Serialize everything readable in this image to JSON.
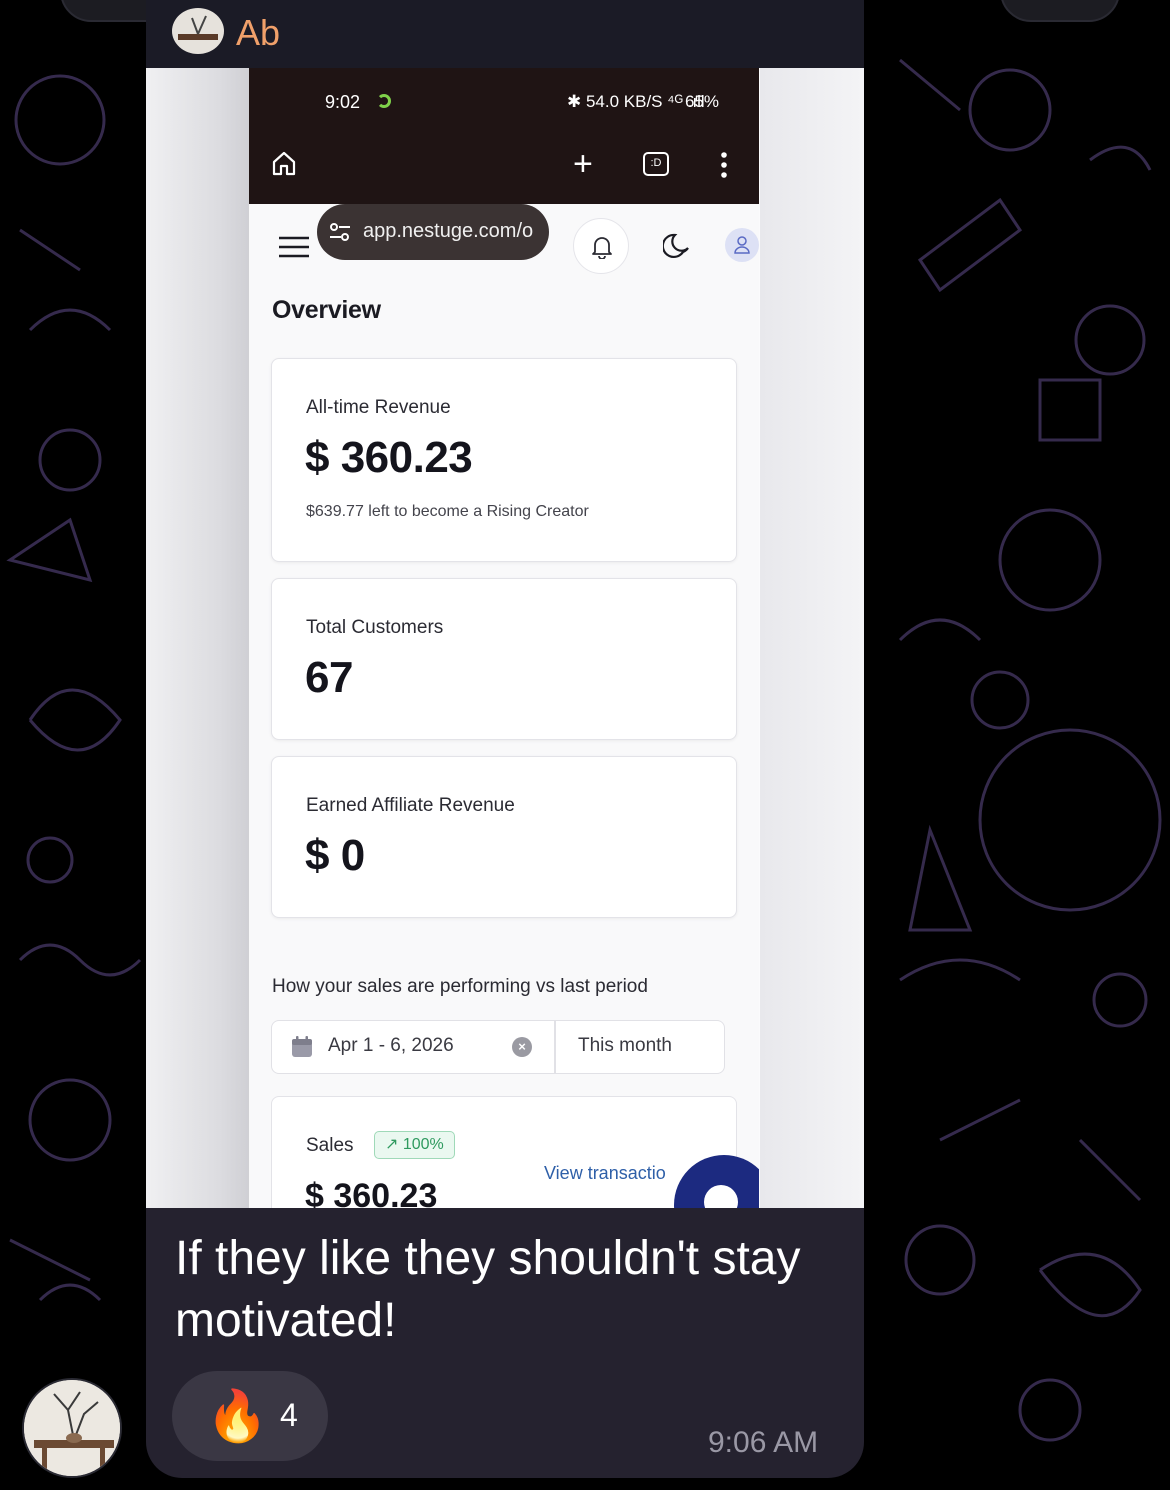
{
  "chat": {
    "sender_name": "Ab",
    "message_text": "If they like they shouldn't stay motivated!",
    "reaction_emoji": "🔥",
    "reaction_count": "4",
    "message_time": "9:06 AM"
  },
  "status_bar": {
    "time": "9:02",
    "indicators": "✱ 54.0 KB/S ⁴ᴳ .ıll",
    "battery": "65%"
  },
  "browser": {
    "url": "app.nestuge.com/o",
    "tabs_label": ":D"
  },
  "page": {
    "title": "Overview",
    "cards": [
      {
        "label": "All-time Revenue",
        "value": "$ 360.23",
        "sub": "$639.77 left to become a Rising Creator"
      },
      {
        "label": "Total Customers",
        "value": "67"
      },
      {
        "label": "Earned Affiliate Revenue",
        "value": "$ 0"
      }
    ],
    "performance_heading": "How your sales are performing vs last period",
    "date_range": "Apr 1 - 6, 2026",
    "period": "This month",
    "sales": {
      "label": "Sales",
      "badge": "↗  100%",
      "value": "$ 360.23",
      "link": "View transactio"
    }
  },
  "colors": {
    "accent_blue": "#1c2a80",
    "link_blue": "#2e5fa8",
    "badge_green": "#2f9a5f",
    "sender_orange": "#f0a06a",
    "bubble_bg": "#25222f"
  }
}
